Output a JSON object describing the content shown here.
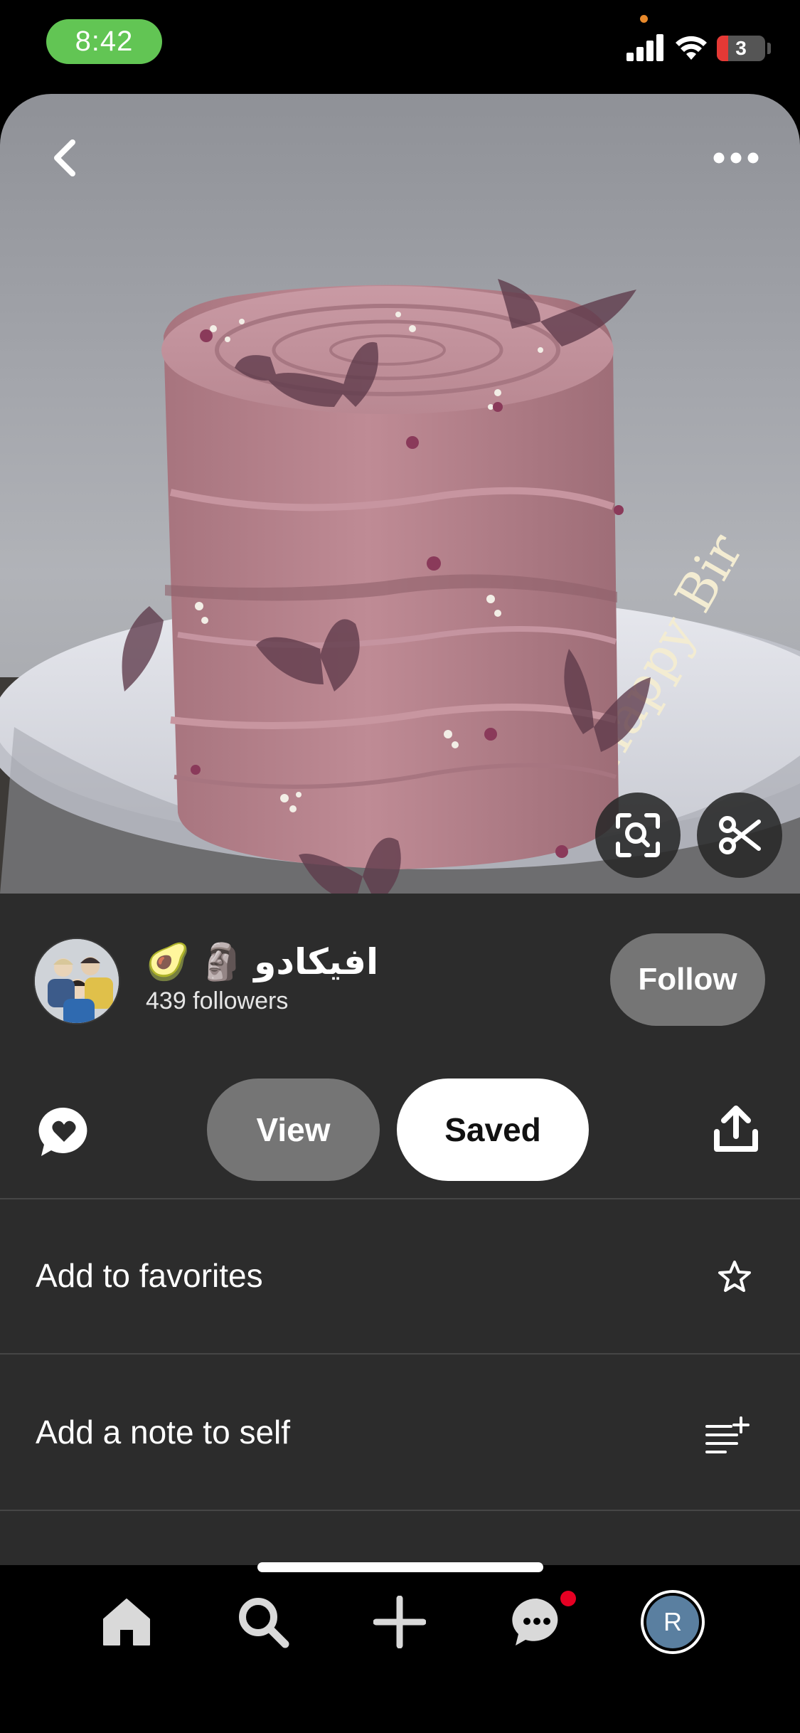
{
  "status_bar": {
    "time": "8:42",
    "battery_level": "3",
    "colors": {
      "time_pill": "#62c554",
      "battery_low": "#e53935",
      "privacy_dot": "#e8892b"
    }
  },
  "pin": {
    "image_icons": {
      "back": "chevron-left-icon",
      "more": "ellipsis-icon",
      "visual_search": "lens-search-icon",
      "cutout": "scissors-icon"
    },
    "cake_lettering": "Happy Bir"
  },
  "author": {
    "name": "🥑 🗿 افيكادو",
    "followers": "439 followers",
    "follow_label": "Follow"
  },
  "actions": {
    "view_label": "View",
    "saved_label": "Saved",
    "comment_icon": "comment-heart-icon",
    "share_icon": "share-icon"
  },
  "rows": [
    {
      "label": "Add to favorites",
      "icon": "star-icon"
    },
    {
      "label": "Add a note to self",
      "icon": "note-add-icon"
    }
  ],
  "tab_bar": {
    "items": [
      "home-icon",
      "search-icon",
      "plus-icon",
      "messages-icon",
      "profile-avatar"
    ],
    "profile_initial": "R",
    "colors": {
      "notification": "#e60023",
      "avatar": "#5a7fa0"
    }
  }
}
